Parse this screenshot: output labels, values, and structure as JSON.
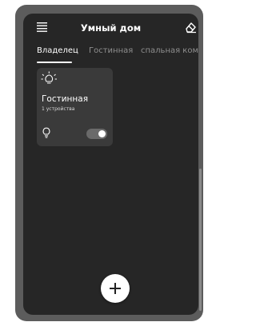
{
  "header": {
    "title": "Умный дом",
    "menu_icon": "menu-icon",
    "eraser_icon": "eraser-icon"
  },
  "tabs": [
    {
      "label": "Владелец",
      "active": true
    },
    {
      "label": "Гостинная",
      "active": false
    },
    {
      "label": "спальная комнат",
      "active": false
    }
  ],
  "room_card": {
    "title": "Гостинная",
    "devices": "1 устройства",
    "icon": "bulb-icon",
    "toggle_on": true
  },
  "fab": {
    "icon": "plus-icon"
  },
  "colors": {
    "screen_bg": "#262626",
    "card_bg": "#3a3a3a",
    "active_text": "#ffffff",
    "inactive_text": "#8f8f8f"
  }
}
